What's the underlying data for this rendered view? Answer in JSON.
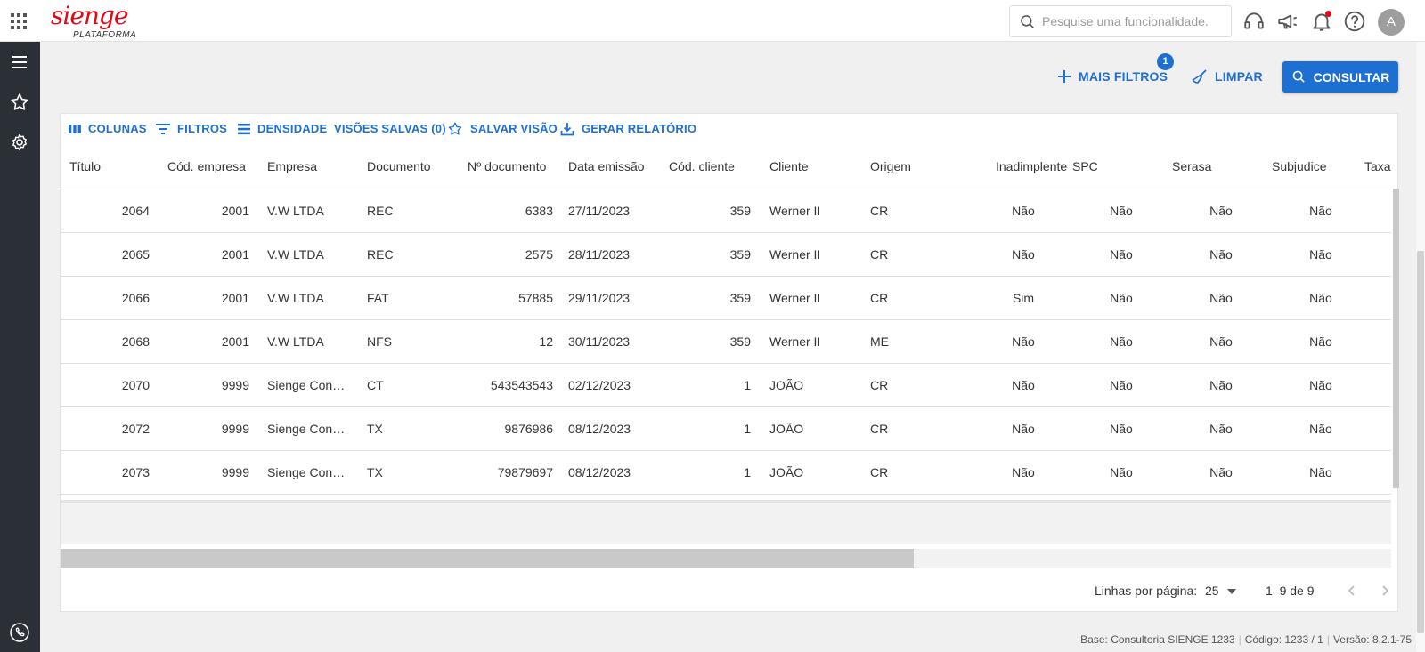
{
  "logo": {
    "brand": "sienge",
    "sub": "PLATAFORMA"
  },
  "search": {
    "placeholder": "Pesquise uma funcionalidade."
  },
  "user": {
    "avatar_letter": "A"
  },
  "actions": {
    "mais_filtros": "MAIS FILTROS",
    "mais_filtros_badge": "1",
    "limpar": "LIMPAR",
    "consultar": "CONSULTAR"
  },
  "toolbar": {
    "colunas": "COLUNAS",
    "filtros": "FILTROS",
    "densidade": "DENSIDADE",
    "visoes": "VISÕES SALVAS (0)",
    "salvar": "SALVAR VISÃO",
    "relatorio": "GERAR RELATÓRIO"
  },
  "table": {
    "columns": [
      "Título",
      "Cód. empresa",
      "Empresa",
      "Documento",
      "Nº documento",
      "Data emissão",
      "Cód. cliente",
      "Cliente",
      "Origem",
      "Inadimplente",
      "SPC",
      "Serasa",
      "Subjudice",
      "Taxa a"
    ],
    "rows": [
      [
        "2064",
        "2001",
        "V.W LTDA",
        "REC",
        "6383",
        "27/11/2023",
        "359",
        "Werner II",
        "CR",
        "Não",
        "Não",
        "Não",
        "Não"
      ],
      [
        "2065",
        "2001",
        "V.W LTDA",
        "REC",
        "2575",
        "28/11/2023",
        "359",
        "Werner II",
        "CR",
        "Não",
        "Não",
        "Não",
        "Não"
      ],
      [
        "2066",
        "2001",
        "V.W LTDA",
        "FAT",
        "57885",
        "29/11/2023",
        "359",
        "Werner II",
        "CR",
        "Sim",
        "Não",
        "Não",
        "Não"
      ],
      [
        "2068",
        "2001",
        "V.W LTDA",
        "NFS",
        "12",
        "30/11/2023",
        "359",
        "Werner II",
        "ME",
        "Não",
        "Não",
        "Não",
        "Não"
      ],
      [
        "2070",
        "9999",
        "Sienge Constr...",
        "CT",
        "543543543",
        "02/12/2023",
        "1",
        "JOÃO",
        "CR",
        "Não",
        "Não",
        "Não",
        "Não"
      ],
      [
        "2072",
        "9999",
        "Sienge Constr...",
        "TX",
        "9876986",
        "08/12/2023",
        "1",
        "JOÃO",
        "CR",
        "Não",
        "Não",
        "Não",
        "Não"
      ],
      [
        "2073",
        "9999",
        "Sienge Constr...",
        "TX",
        "79879697",
        "08/12/2023",
        "1",
        "JOÃO",
        "CR",
        "Não",
        "Não",
        "Não",
        "Não"
      ]
    ]
  },
  "pagination": {
    "rows_per_page_label": "Linhas por página:",
    "rows_per_page_value": "25",
    "range": "1–9 de 9"
  },
  "status": {
    "base": "Base: Consultoria SIENGE 1233",
    "codigo": "Código: 1233 / 1",
    "versao": "Versão: 8.2.1-75"
  },
  "colors": {
    "accent": "#1d6fd1",
    "brand": "#e30613",
    "rail": "#2b2f36"
  }
}
